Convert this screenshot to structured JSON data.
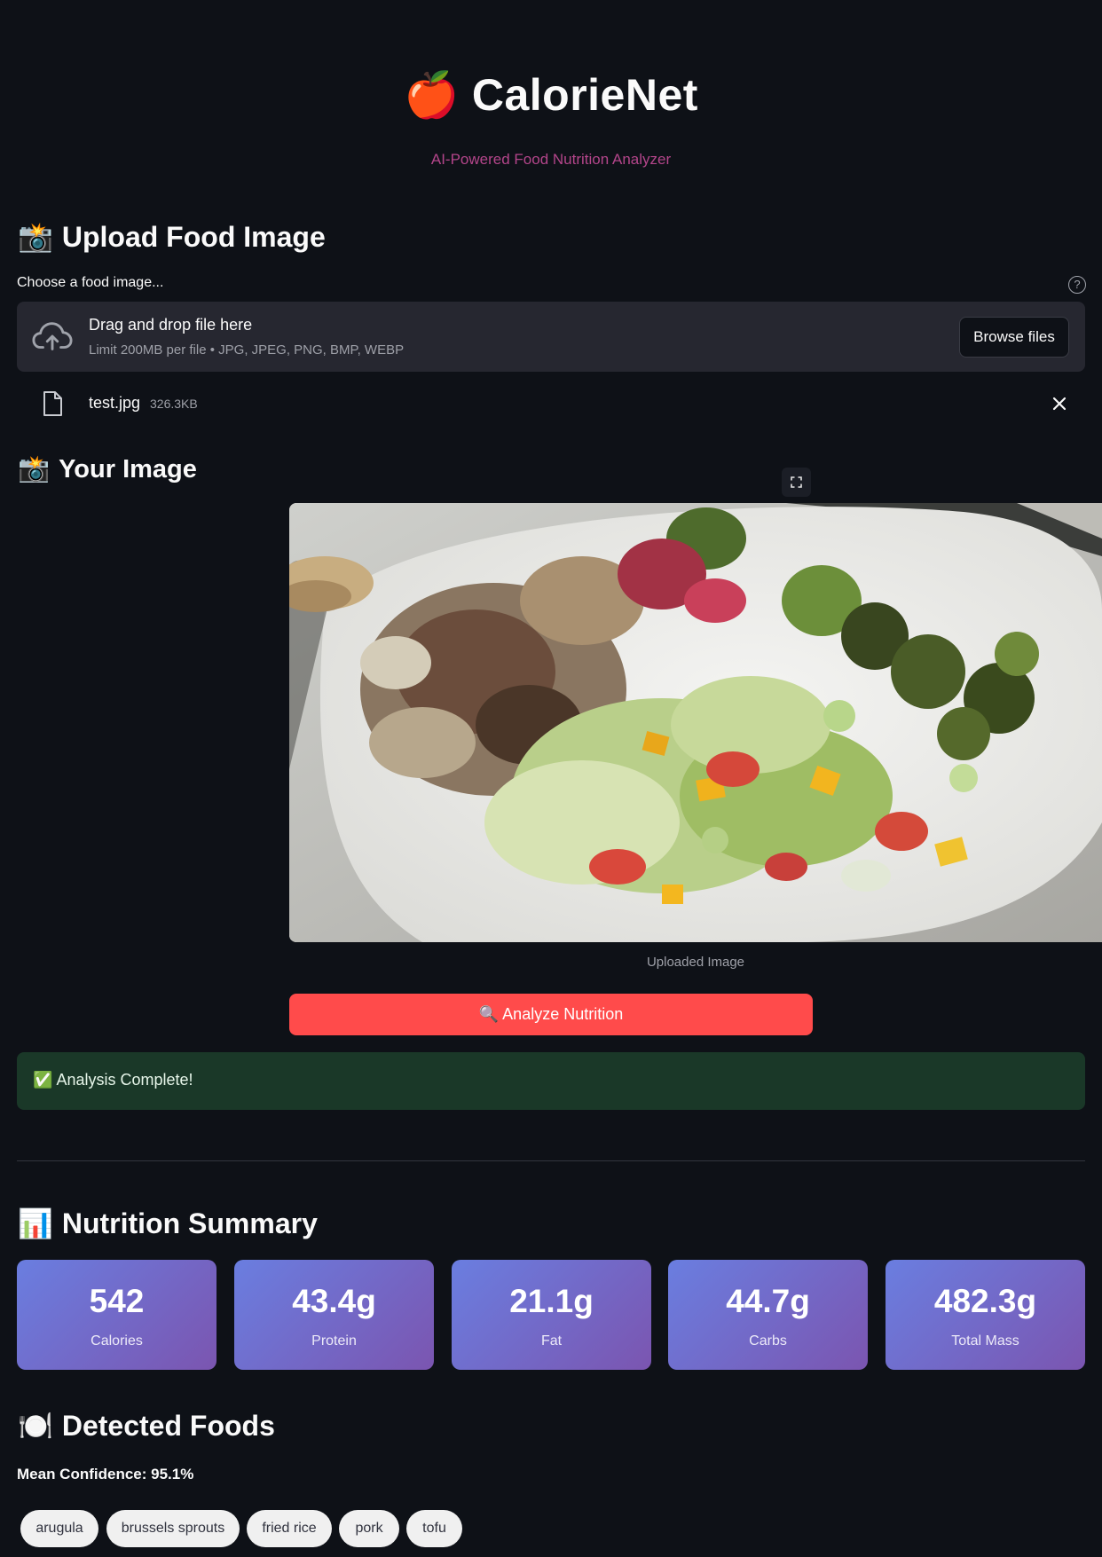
{
  "header": {
    "logo_emoji": "🍎",
    "title": "CalorieNet",
    "subtitle": "AI-Powered Food Nutrition Analyzer"
  },
  "upload_section": {
    "emoji": "📸",
    "heading": "Upload Food Image",
    "label": "Choose a food image...",
    "help_icon": "question-circle-icon",
    "dropzone_title": "Drag and drop file here",
    "dropzone_subtitle": "Limit 200MB per file • JPG, JPEG, PNG, BMP, WEBP",
    "browse_label": "Browse files",
    "file": {
      "name": "test.jpg",
      "size": "326.3KB"
    }
  },
  "image_section": {
    "emoji": "📸",
    "heading": "Your Image",
    "caption": "Uploaded Image"
  },
  "analyze_button": {
    "emoji": "🔍",
    "label": "Analyze Nutrition"
  },
  "status": {
    "emoji": "✅",
    "message": "Analysis Complete!"
  },
  "summary": {
    "emoji": "📊",
    "heading": "Nutrition Summary",
    "metrics": [
      {
        "value": "542",
        "label": "Calories"
      },
      {
        "value": "43.4g",
        "label": "Protein"
      },
      {
        "value": "21.1g",
        "label": "Fat"
      },
      {
        "value": "44.7g",
        "label": "Carbs"
      },
      {
        "value": "482.3g",
        "label": "Total Mass"
      }
    ]
  },
  "detected": {
    "emoji": "🍽️",
    "heading": "Detected Foods",
    "confidence": "Mean Confidence: 95.1%",
    "foods": [
      "arugula",
      "brussels sprouts",
      "fried rice",
      "pork",
      "tofu"
    ]
  },
  "colors": {
    "background": "#0e1117",
    "accent_button": "#ff4b4b",
    "subtitle": "#b3458a",
    "success_bg": "#1a3828",
    "card_gradient_start": "#6a7ee0",
    "card_gradient_end": "#7b55b0"
  }
}
